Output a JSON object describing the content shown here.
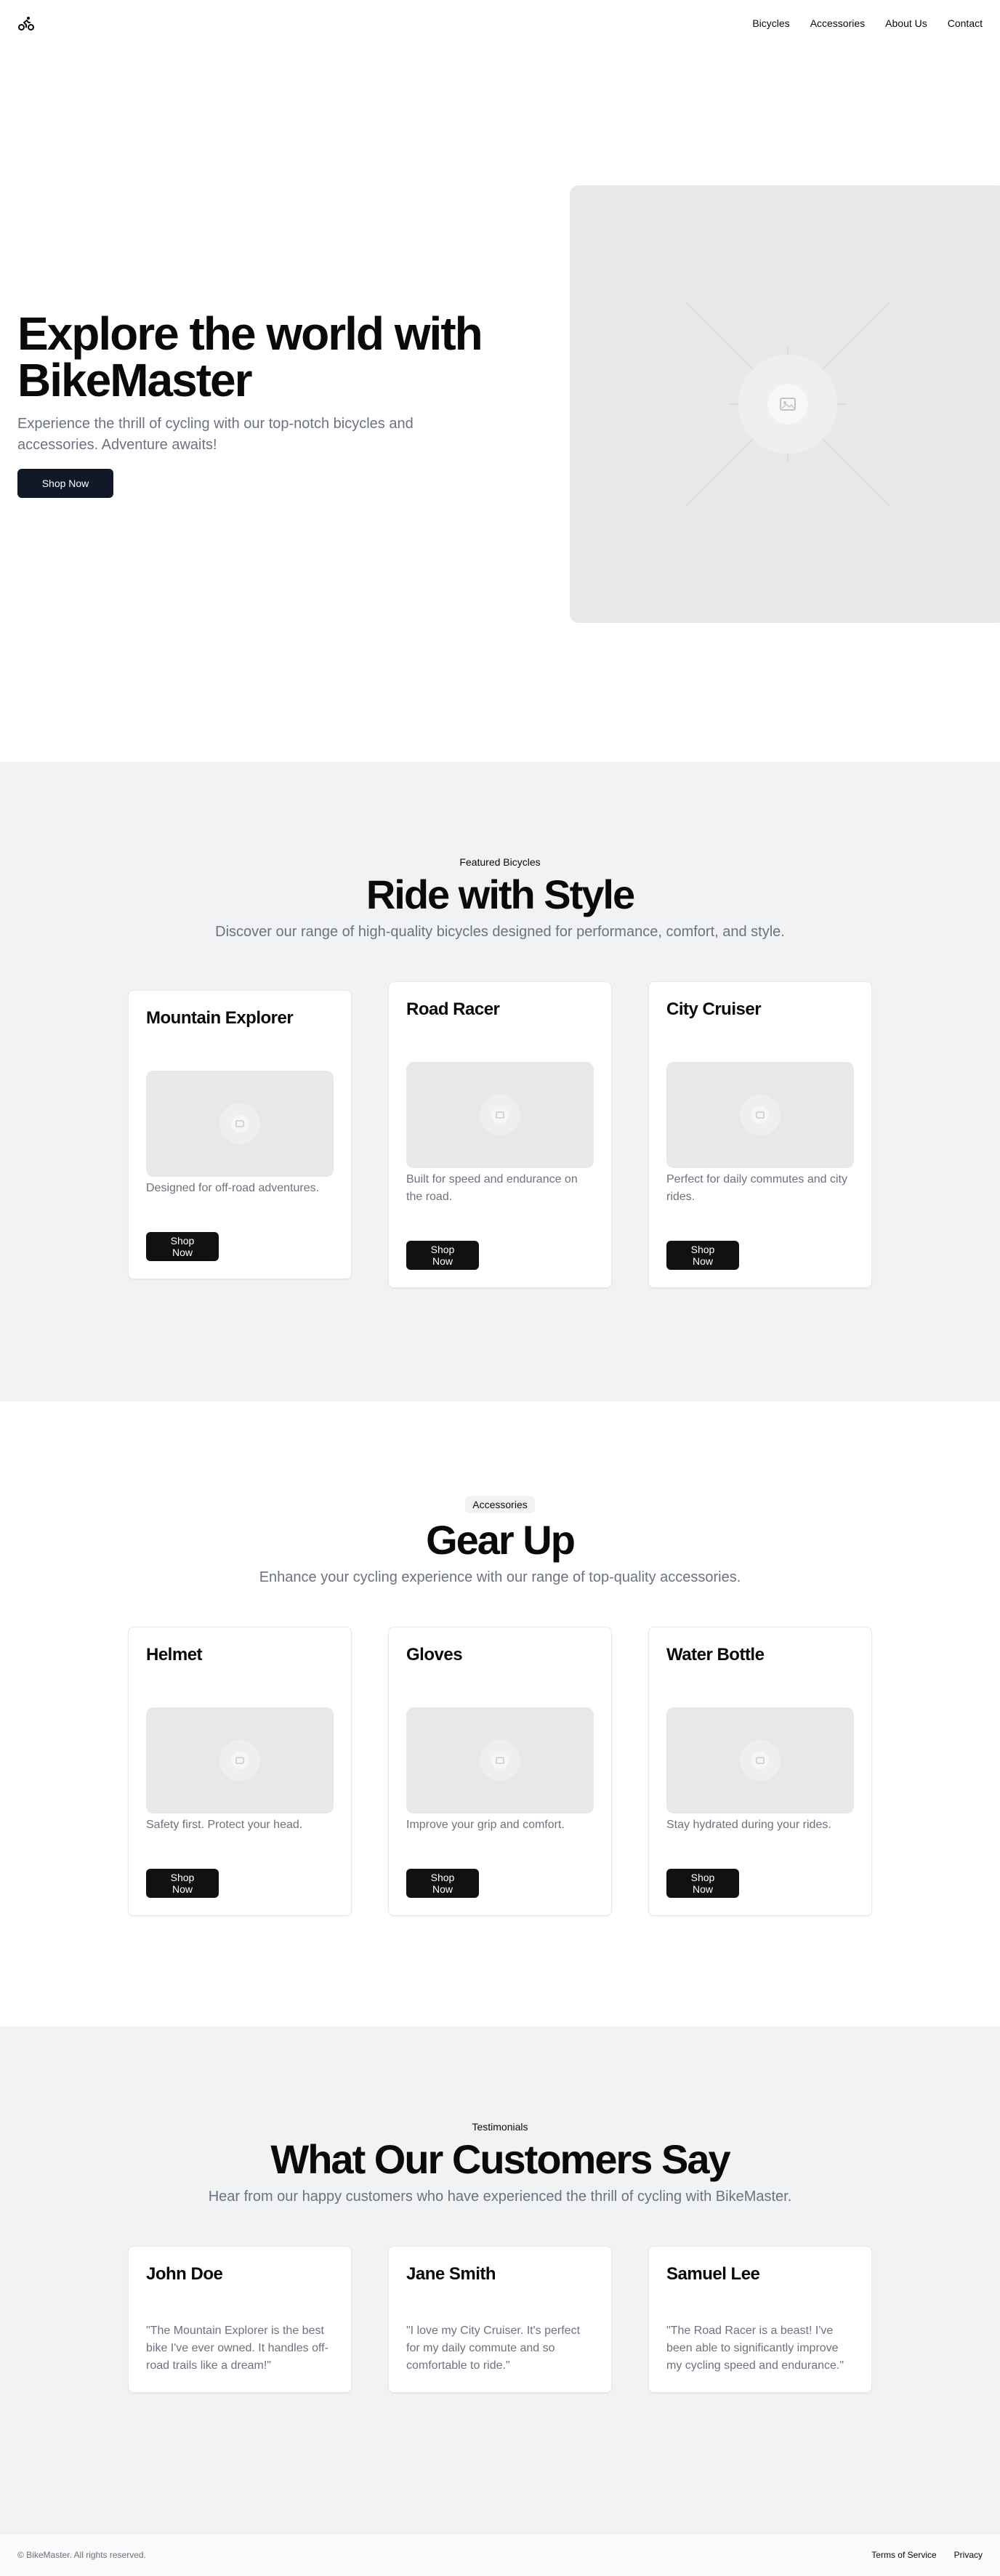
{
  "nav": {
    "logo_icon": "bicycle-icon",
    "items": [
      {
        "label": "Bicycles"
      },
      {
        "label": "Accessories"
      },
      {
        "label": "About Us"
      },
      {
        "label": "Contact"
      }
    ]
  },
  "hero": {
    "title": "Explore the world with BikeMaster",
    "subtitle": "Experience the thrill of cycling with our top-notch bicycles and accessories. Adventure awaits!",
    "cta": "Shop Now",
    "image_icon": "image-placeholder-icon"
  },
  "featured": {
    "eyebrow": "Featured Bicycles",
    "title": "Ride with Style",
    "subtitle": "Discover our range of high-quality bicycles designed for performance, comfort, and style.",
    "cards": [
      {
        "title": "Mountain Explorer",
        "desc": "Designed for off-road adventures.",
        "cta": "Shop Now"
      },
      {
        "title": "Road Racer",
        "desc": "Built for speed and endurance on the road.",
        "cta": "Shop Now"
      },
      {
        "title": "City Cruiser",
        "desc": "Perfect for daily commutes and city rides.",
        "cta": "Shop Now"
      }
    ]
  },
  "accessories": {
    "eyebrow": "Accessories",
    "title": "Gear Up",
    "subtitle": "Enhance your cycling experience with our range of top-quality accessories.",
    "cards": [
      {
        "title": "Helmet",
        "desc": "Safety first. Protect your head.",
        "cta": "Shop Now"
      },
      {
        "title": "Gloves",
        "desc": "Improve your grip and comfort.",
        "cta": "Shop Now"
      },
      {
        "title": "Water Bottle",
        "desc": "Stay hydrated during your rides.",
        "cta": "Shop Now"
      }
    ]
  },
  "testimonials": {
    "eyebrow": "Testimonials",
    "title": "What Our Customers Say",
    "subtitle": "Hear from our happy customers who have experienced the thrill of cycling with BikeMaster.",
    "items": [
      {
        "name": "John Doe",
        "quote": "\"The Mountain Explorer is the best bike I've ever owned. It handles off-road trails like a dream!\""
      },
      {
        "name": "Jane Smith",
        "quote": "\"I love my City Cruiser. It's perfect for my daily commute and so comfortable to ride.\""
      },
      {
        "name": "Samuel Lee",
        "quote": "\"The Road Racer is a beast! I've been able to significantly improve my cycling speed and endurance.\""
      }
    ]
  },
  "footer": {
    "copyright": "© BikeMaster. All rights reserved.",
    "links": [
      {
        "label": "Terms of Service"
      },
      {
        "label": "Privacy"
      }
    ]
  },
  "colors": {
    "text": "#0a0a0a",
    "muted": "#6b7280",
    "button": "#111111",
    "section_grey": "#f1f2f4",
    "placeholder": "#e8e8e8"
  }
}
